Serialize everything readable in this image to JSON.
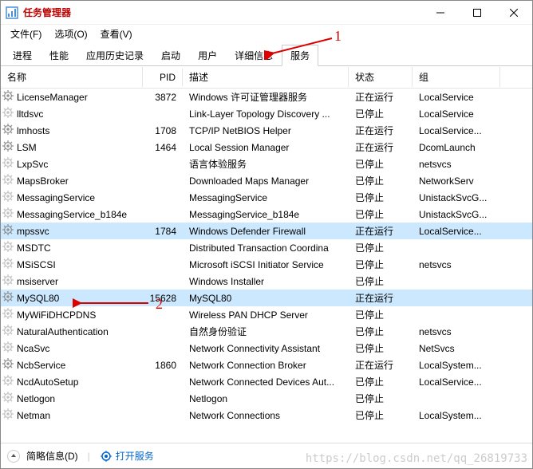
{
  "window": {
    "title": "任务管理器"
  },
  "menu": {
    "file": "文件(F)",
    "options": "选项(O)",
    "view": "查看(V)"
  },
  "tabs": [
    "进程",
    "性能",
    "应用历史记录",
    "启动",
    "用户",
    "详细信息",
    "服务"
  ],
  "activeTab": 6,
  "columns": {
    "name": "名称",
    "pid": "PID",
    "desc": "描述",
    "status": "状态",
    "group": "组"
  },
  "statusText": {
    "running": "正在运行",
    "stopped": "已停止"
  },
  "rows": [
    {
      "name": "LicenseManager",
      "pid": "3872",
      "desc": "Windows 许可证管理器服务",
      "status": "running",
      "group": "LocalService"
    },
    {
      "name": "lltdsvc",
      "pid": "",
      "desc": "Link-Layer Topology Discovery ...",
      "status": "stopped",
      "group": "LocalService"
    },
    {
      "name": "lmhosts",
      "pid": "1708",
      "desc": "TCP/IP NetBIOS Helper",
      "status": "running",
      "group": "LocalService..."
    },
    {
      "name": "LSM",
      "pid": "1464",
      "desc": "Local Session Manager",
      "status": "running",
      "group": "DcomLaunch"
    },
    {
      "name": "LxpSvc",
      "pid": "",
      "desc": "语言体验服务",
      "status": "stopped",
      "group": "netsvcs"
    },
    {
      "name": "MapsBroker",
      "pid": "",
      "desc": "Downloaded Maps Manager",
      "status": "stopped",
      "group": "NetworkServ"
    },
    {
      "name": "MessagingService",
      "pid": "",
      "desc": "MessagingService",
      "status": "stopped",
      "group": "UnistackSvcG..."
    },
    {
      "name": "MessagingService_b184e",
      "pid": "",
      "desc": "MessagingService_b184e",
      "status": "stopped",
      "group": "UnistackSvcG..."
    },
    {
      "name": "mpssvc",
      "pid": "1784",
      "desc": "Windows Defender Firewall",
      "status": "running",
      "group": "LocalService...",
      "sel": true
    },
    {
      "name": "MSDTC",
      "pid": "",
      "desc": "Distributed Transaction Coordina",
      "status": "stopped",
      "group": ""
    },
    {
      "name": "MSiSCSI",
      "pid": "",
      "desc": "Microsoft iSCSI Initiator Service",
      "status": "stopped",
      "group": "netsvcs"
    },
    {
      "name": "msiserver",
      "pid": "",
      "desc": "Windows Installer",
      "status": "stopped",
      "group": ""
    },
    {
      "name": "MySQL80",
      "pid": "15628",
      "desc": "MySQL80",
      "status": "running",
      "group": "",
      "sel": true
    },
    {
      "name": "MyWiFiDHCPDNS",
      "pid": "",
      "desc": "Wireless PAN DHCP Server",
      "status": "stopped",
      "group": ""
    },
    {
      "name": "NaturalAuthentication",
      "pid": "",
      "desc": "自然身份验证",
      "status": "stopped",
      "group": "netsvcs"
    },
    {
      "name": "NcaSvc",
      "pid": "",
      "desc": "Network Connectivity Assistant",
      "status": "stopped",
      "group": "NetSvcs"
    },
    {
      "name": "NcbService",
      "pid": "1860",
      "desc": "Network Connection Broker",
      "status": "running",
      "group": "LocalSystem..."
    },
    {
      "name": "NcdAutoSetup",
      "pid": "",
      "desc": "Network Connected Devices Aut...",
      "status": "stopped",
      "group": "LocalService..."
    },
    {
      "name": "Netlogon",
      "pid": "",
      "desc": "Netlogon",
      "status": "stopped",
      "group": ""
    },
    {
      "name": "Netman",
      "pid": "",
      "desc": "Network Connections",
      "status": "stopped",
      "group": "LocalSystem..."
    }
  ],
  "statusbar": {
    "brief": "简略信息(D)",
    "open": "打开服务"
  },
  "annotations": {
    "one": "1",
    "two": "2"
  },
  "watermark": "https://blog.csdn.net/qq_26819733"
}
